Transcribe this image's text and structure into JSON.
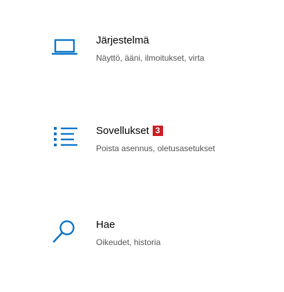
{
  "accent_color": "#0a74c8",
  "badge_color": "#cc1d23",
  "categories": [
    {
      "title": "Järjestelmä",
      "description": "Näyttö, ääni, ilmoitukset, virta",
      "icon": "laptop-icon"
    },
    {
      "title": "Sovellukset",
      "description": "Poista asennus, oletusasetukset",
      "icon": "app-list-icon",
      "badge": "3"
    },
    {
      "title": "Hae",
      "description": "Oikeudet, historia",
      "icon": "search-icon"
    }
  ]
}
